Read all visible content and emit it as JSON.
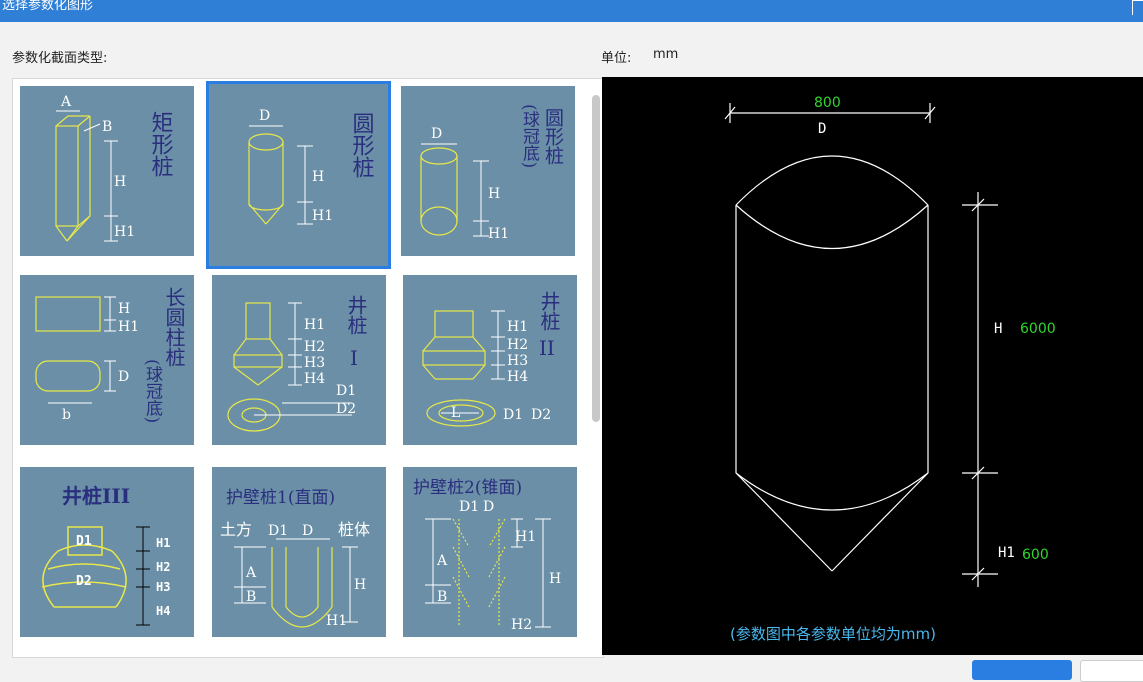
{
  "window": {
    "title": "选择参数化图形"
  },
  "section_label": "参数化截面类型:",
  "unit": {
    "label": "单位:",
    "value": "mm"
  },
  "shapes": [
    {
      "name": "矩形桩",
      "labels": [
        "A",
        "B",
        "H",
        "H1"
      ]
    },
    {
      "name": "圆形桩",
      "labels": [
        "D",
        "H",
        "H1"
      ]
    },
    {
      "name": "圆形桩",
      "sub": "(球冠底)",
      "labels": [
        "D",
        "H",
        "H1"
      ]
    },
    {
      "name": "长圆柱桩",
      "sub": "(球冠底)",
      "labels": [
        "H",
        "H1",
        "D",
        "b"
      ]
    },
    {
      "name": "井桩",
      "sub": "I",
      "labels": [
        "H1",
        "H2",
        "H3",
        "H4",
        "D1",
        "D2"
      ]
    },
    {
      "name": "井桩",
      "sub": "II",
      "labels": [
        "H1",
        "H2",
        "H3",
        "H4",
        "L",
        "D1",
        "D2"
      ]
    },
    {
      "name": "井桩III",
      "labels": [
        "D1",
        "D2",
        "H1",
        "H2",
        "H3",
        "H4"
      ]
    },
    {
      "name": "护壁桩1(直面)",
      "labels": [
        "土方",
        "D1",
        "D",
        "桩体",
        "A",
        "B",
        "H",
        "H1"
      ]
    },
    {
      "name": "护壁桩2(锥面)",
      "labels": [
        "D1",
        "D",
        "A",
        "B",
        "H1",
        "H",
        "H2"
      ]
    }
  ],
  "preview": {
    "D_label": "D",
    "D_value": "800",
    "H_label": "H",
    "H_value": "6000",
    "H1_label": "H1",
    "H1_value": "600",
    "note": "(参数图中各参数单位均为mm)"
  },
  "colors": {
    "titlebar": "#2f7fd6",
    "tile_bg": "#6a8fa6",
    "shape_line": "#e8e84a",
    "dim_green": "#2fd62f",
    "selection": "#2a7de1"
  }
}
